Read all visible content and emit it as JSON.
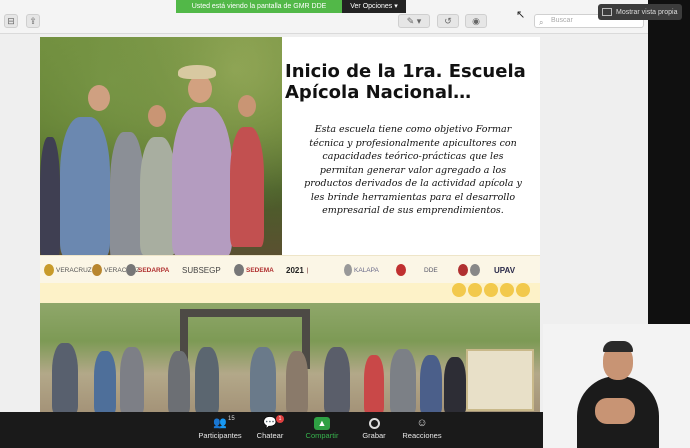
{
  "banner": {
    "message": "Usted está viendo la pantalla de GMR DDE",
    "options": "Ver Opciones ▾"
  },
  "view_button": "Mostrar vista propia",
  "app_toolbar": {
    "search_placeholder": "Buscar"
  },
  "slide": {
    "title": "Inicio de la 1ra. Escuela Apícola Nacional…",
    "description": "Esta escuela tiene como objetivo Formar técnica y profesionalmente apicultores con capacidades teórico-prácticas que les permitan generar valor agregado a los productos derivados de la actividad apícola y les brinde herramientas para el desarrollo empresarial de sus emprendimientos.",
    "logos": [
      "SEDARPA",
      "SUBSEGP",
      "SEDEMA",
      "2021",
      "KALAPA",
      "DDE",
      "UPAV"
    ]
  },
  "toolbar": {
    "items": [
      {
        "label": "Participantes",
        "icon": "participants-icon",
        "count": "15"
      },
      {
        "label": "Chatear",
        "icon": "chat-icon",
        "badge": "1"
      },
      {
        "label": "Compartir",
        "icon": "share-screen-icon"
      },
      {
        "label": "Grabar",
        "icon": "record-icon"
      },
      {
        "label": "Reacciones",
        "icon": "reactions-icon"
      }
    ]
  },
  "colors": {
    "share_green": "#52b848",
    "toolbar_bg": "#1a1a1a",
    "share_active": "#2ea043"
  }
}
